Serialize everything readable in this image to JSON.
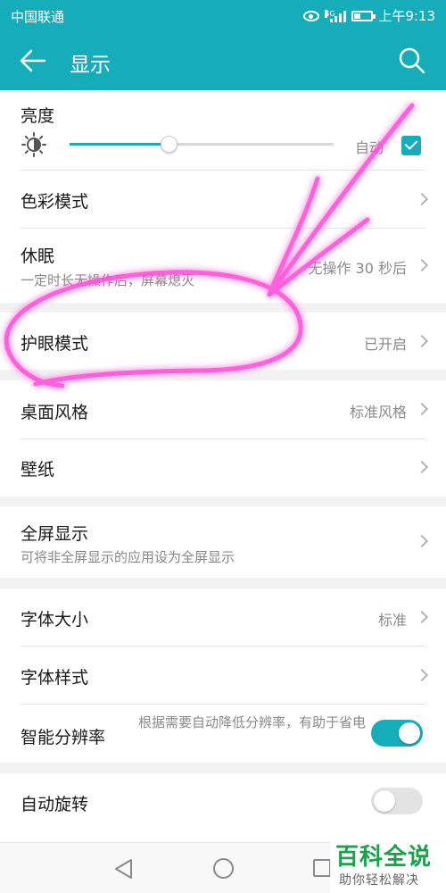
{
  "status_bar": {
    "carrier": "中国联通",
    "network": "4G",
    "time": "上午9:13",
    "battery_level": 0.35
  },
  "header": {
    "title": "显示",
    "back_icon": "arrow-left-icon",
    "search_icon": "search-icon"
  },
  "brightness": {
    "label": "亮度",
    "level": 0.38,
    "auto_label": "自动",
    "auto_checked": true
  },
  "settings": {
    "color_mode": {
      "label": "色彩模式"
    },
    "sleep": {
      "label": "休眠",
      "subtitle": "一定时长无操作后，屏幕熄灭",
      "value": "无操作 30 秒后"
    },
    "eye_comfort": {
      "label": "护眼模式",
      "value": "已开启"
    },
    "desktop_style": {
      "label": "桌面风格",
      "value": "标准风格"
    },
    "wallpaper": {
      "label": "壁纸"
    },
    "full_screen": {
      "label": "全屏显示",
      "subtitle": "可将非全屏显示的应用设为全屏显示"
    },
    "font_size": {
      "label": "字体大小",
      "value": "标准"
    },
    "font_style": {
      "label": "字体样式"
    },
    "smart_resolution": {
      "label": "智能分辨率",
      "value": "根据需要自动降低分辨率，有助于省电",
      "enabled": true
    },
    "auto_rotate": {
      "label": "自动旋转",
      "enabled": false
    }
  },
  "navbar": {
    "back": "triangle-back-icon",
    "home": "circle-home-icon",
    "recent": "square-recent-icon"
  },
  "watermark": {
    "title": "百科全说",
    "subtitle": "助你轻松解决"
  },
  "colors": {
    "accent": "#14adb9",
    "annotation": "#ff4fd8"
  }
}
